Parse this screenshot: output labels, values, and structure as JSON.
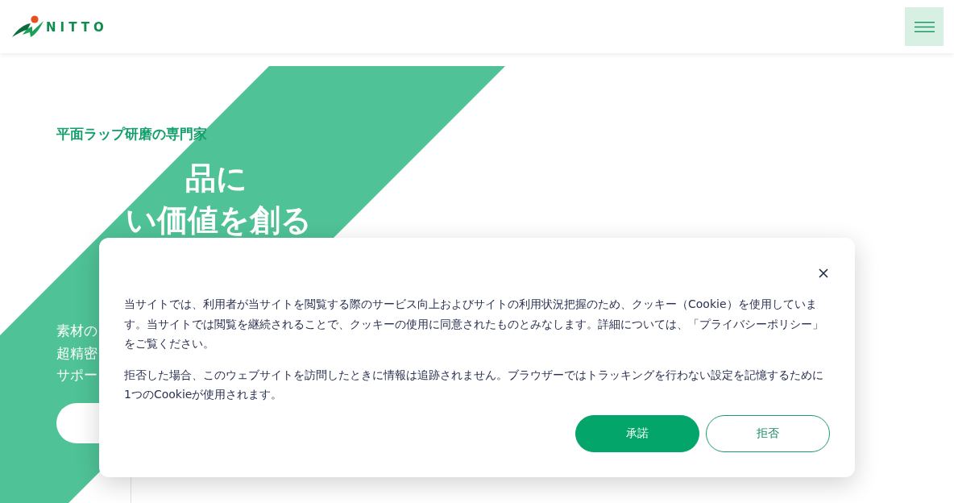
{
  "header": {
    "logo_text": "NITTO"
  },
  "hero": {
    "eyebrow": "平面ラップ研磨の専門家",
    "headline_lines": [
      "品に",
      "い価値を創る"
    ],
    "lead_lines": [
      "素材の",
      "超精密",
      "サポー"
    ]
  },
  "cookie_dialog": {
    "paragraphs": [
      "当サイトでは、利用者が当サイトを閲覧する際のサービス向上およびサイトの利用状況把握のため、クッキー（Cookie）を使用しています。当サイトでは閲覧を継続されることで、クッキーの使用に同意されたものとみなします。詳細については、「プライバシーポリシー」をご覧ください。",
      "拒否した場合、このウェブサイトを訪問したときに情報は追跡されません。ブラウザーではトラッキングを行わない設定を記憶するために1つのCookieが使用されます。"
    ],
    "buttons": [
      {
        "label": "承諾",
        "kind": "primary"
      },
      {
        "label": "拒否",
        "kind": "secondary"
      }
    ]
  }
}
